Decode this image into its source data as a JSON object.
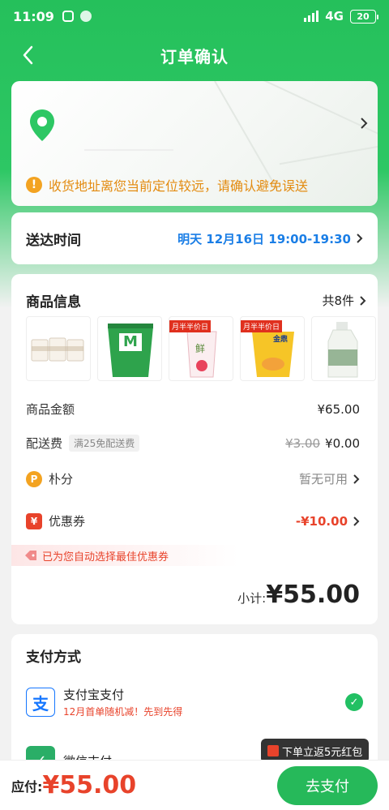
{
  "status_bar": {
    "time": "11:09",
    "network": "4G",
    "battery": "20"
  },
  "nav": {
    "title": "订单确认"
  },
  "address": {
    "warning": "收货地址离您当前定位较远，请确认避免误送"
  },
  "delivery": {
    "label": "送达时间",
    "value": "明天 12月16日 19:00-19:30"
  },
  "goods": {
    "title": "商品信息",
    "count": "共8件",
    "thumb_tag": "月半半价日",
    "thumb_label_m": "M",
    "thumb_label_fresh": "鲜",
    "thumb_label_jin": "金鼎"
  },
  "summary": {
    "goods_amount_label": "商品金额",
    "goods_amount": "¥65.00",
    "delivery_fee_label": "配送费",
    "delivery_fee_tag": "满25免配送费",
    "delivery_fee_original": "¥3.00",
    "delivery_fee": "¥0.00",
    "points_label": "朴分",
    "points_value": "暂无可用",
    "coupon_label": "优惠券",
    "coupon_value": "-¥10.00",
    "auto_coupon_text": "已为您自动选择最佳优惠券",
    "subtotal_label": "小计:",
    "subtotal_amount": "¥55.00"
  },
  "payment": {
    "title": "支付方式",
    "alipay_name": "支付宝支付",
    "alipay_promo": "12月首单随机减！先到先得",
    "wechat_name": "微信支付"
  },
  "footer": {
    "total_label": "应付:",
    "total_amount": "¥55.00",
    "pay_button": "去支付",
    "tooltip": "下单立返5元红包"
  },
  "colors": {
    "brand_green": "#26b95a",
    "accent_red": "#e8432b",
    "link_blue": "#1a7ee6",
    "warning": "#e38b10"
  }
}
